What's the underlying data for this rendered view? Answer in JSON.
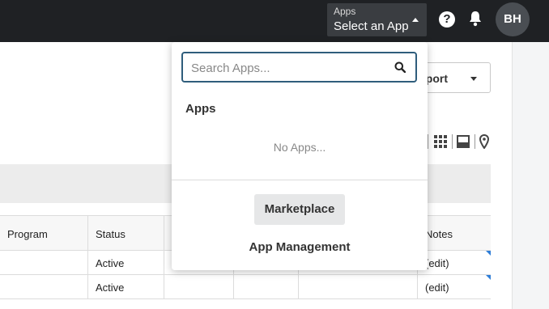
{
  "topbar": {
    "app_select": {
      "small_label": "Apps",
      "value": "Select an App"
    },
    "help_icon": "question-circle-icon",
    "help_glyph": "?",
    "bell_icon": "bell-icon",
    "avatar_initials": "BH"
  },
  "toolbar": {
    "export_label": "xport",
    "view_icons": [
      "grid-icon",
      "card-icon",
      "map-pin-icon"
    ]
  },
  "table": {
    "columns": [
      "Program",
      "Status",
      "",
      "",
      "",
      "Notes"
    ],
    "rows": [
      [
        "",
        "Active",
        "",
        "",
        "",
        "(edit)"
      ],
      [
        "",
        "Active",
        "",
        "",
        "",
        "(edit)"
      ]
    ]
  },
  "popover": {
    "search_placeholder": "Search Apps...",
    "apps_heading": "Apps",
    "empty_text": "No Apps...",
    "marketplace_label": "Marketplace",
    "app_management_label": "App Management"
  },
  "colors": {
    "topbar": "#1f2124",
    "app_select_bg": "#3a3d41",
    "search_border": "#2f5d7c",
    "corner_marker": "#2f7ed8"
  }
}
